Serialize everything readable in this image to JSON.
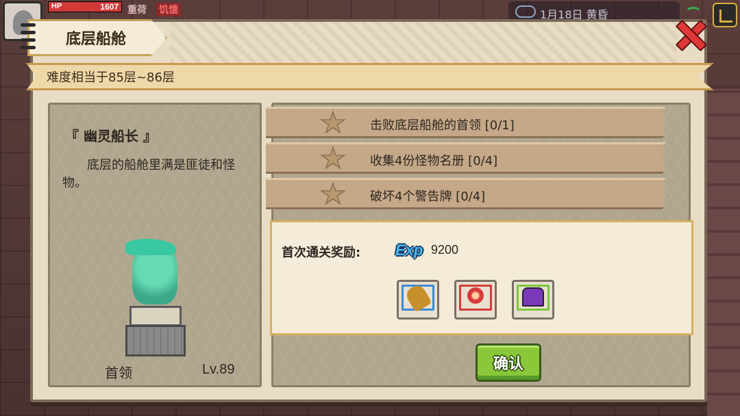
{
  "hud": {
    "hp_label": "HP",
    "hp_value": "1607",
    "hp_fraction": 1.0,
    "status_weight": "重荷",
    "status_hunger": "饥饿",
    "clock": "1月18日  黄昏"
  },
  "dialog": {
    "title": "底层船舱",
    "difficulty": "难度相当于85层~86层"
  },
  "boss": {
    "name": "『 幽灵船长 』",
    "description": "底层的船舱里满是匪徒和怪物。",
    "rank": "首领",
    "level": "Lv.89"
  },
  "objectives": [
    {
      "text": "击败底层船舱的首领 [0/1]"
    },
    {
      "text": "收集4份怪物名册 [0/4]"
    },
    {
      "text": "破坏4个警告牌 [0/4]"
    }
  ],
  "reward": {
    "label": "首次通关奖励:",
    "exp_badge": "Exp",
    "exp_value": "9200",
    "items": [
      {
        "icon": "scroll-icon",
        "frame_color": "#3a8ad8"
      },
      {
        "icon": "orb-icon",
        "frame_color": "#d83a3a"
      },
      {
        "icon": "chest-icon",
        "frame_color": "#7ac83a"
      }
    ]
  },
  "buttons": {
    "confirm": "确认"
  }
}
